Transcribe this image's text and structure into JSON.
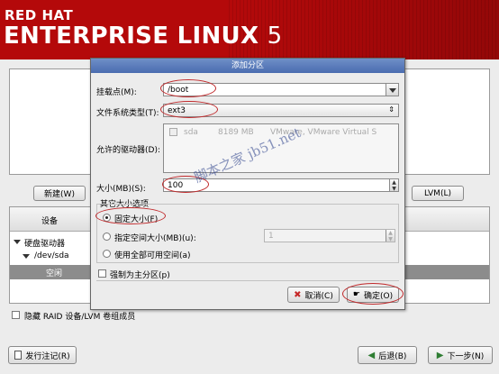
{
  "banner": {
    "line1": "RED HAT",
    "line2": "ENTERPRISE LINUX",
    "version": "5"
  },
  "main": {
    "new_button": "新建(W)",
    "lvm_button": "LVM(L)",
    "device_column": "设备",
    "tree": [
      {
        "label": "硬盘驱动器"
      },
      {
        "label": "/dev/sda"
      },
      {
        "label": "空闲"
      }
    ],
    "hide_raid_label": "隐藏 RAID 设备/LVM 卷组成员",
    "release_notes_button": "发行注记(R)",
    "back_button": "后退(B)",
    "next_button": "下一步(N)"
  },
  "dialog": {
    "title": "添加分区",
    "mount_label": "挂载点(M):",
    "mount_value": "/boot",
    "fstype_label": "文件系统类型(T):",
    "fstype_value": "ext3",
    "drives_label": "允许的驱动器(D):",
    "drive_row": {
      "name": "sda",
      "size": "8189 MB",
      "model": "VMware, VMware Virtual S"
    },
    "size_label": "大小(MB)(S):",
    "size_value": "100",
    "other_size_group": "其它大小选项",
    "fixed_size_option": "固定大小(F)",
    "fill_to_option": "指定空间大小(MB)(u):",
    "fill_to_value": "1",
    "fill_max_option": "使用全部可用空间(a)",
    "primary_checkbox": "强制为主分区(p)",
    "cancel_button": "取消(C)",
    "ok_button": "确定(O)"
  },
  "watermark": "脚本之家 jb51.net",
  "colors": {
    "banner": "#b4090a",
    "title_bar": "#4a6cb0",
    "highlight_ring": "#c0292b"
  }
}
